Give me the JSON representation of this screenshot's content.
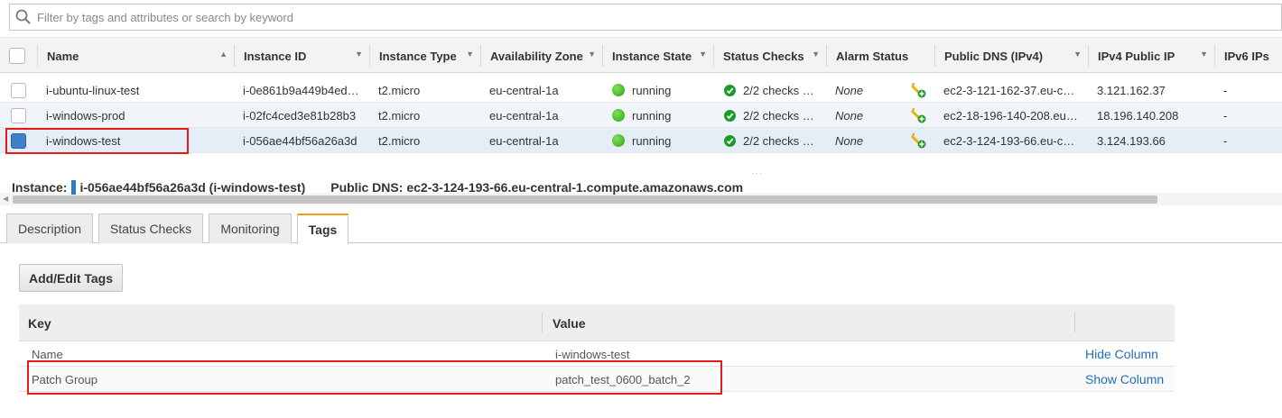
{
  "search": {
    "placeholder": "Filter by tags and attributes or search by keyword"
  },
  "columns": [
    {
      "label": "Name",
      "sort": "▲"
    },
    {
      "label": "Instance ID",
      "sort": "▼"
    },
    {
      "label": "Instance Type",
      "sort": "▼"
    },
    {
      "label": "Availability Zone",
      "sort": "▼"
    },
    {
      "label": "Instance State",
      "sort": "▼"
    },
    {
      "label": "Status Checks",
      "sort": "▼"
    },
    {
      "label": "Alarm Status",
      "sort": ""
    },
    {
      "label": "Public DNS (IPv4)",
      "sort": "▼"
    },
    {
      "label": "IPv4 Public IP",
      "sort": "▼"
    },
    {
      "label": "IPv6 IPs",
      "sort": ""
    }
  ],
  "rows": [
    {
      "name": "i-ubuntu-linux-test",
      "id": "i-0e861b9a449b4ed…",
      "type": "t2.micro",
      "az": "eu-central-1a",
      "state": "running",
      "checks": "2/2 checks …",
      "alarm": "None",
      "dns": "ec2-3-121-162-37.eu-c…",
      "ip": "3.121.162.37",
      "ipv6": "-",
      "selected": false
    },
    {
      "name": "i-windows-prod",
      "id": "i-02fc4ced3e81b28b3",
      "type": "t2.micro",
      "az": "eu-central-1a",
      "state": "running",
      "checks": "2/2 checks …",
      "alarm": "None",
      "dns": "ec2-18-196-140-208.eu…",
      "ip": "18.196.140.208",
      "ipv6": "-",
      "selected": false
    },
    {
      "name": "i-windows-test",
      "id": "i-056ae44bf56a26a3d",
      "type": "t2.micro",
      "az": "eu-central-1a",
      "state": "running",
      "checks": "2/2 checks …",
      "alarm": "None",
      "dns": "ec2-3-124-193-66.eu-c…",
      "ip": "3.124.193.66",
      "ipv6": "-",
      "selected": true
    }
  ],
  "detail": {
    "instance_label": "Instance:",
    "instance_value": "i-056ae44bf56a26a3d (i-windows-test)",
    "dns_label": "Public DNS:",
    "dns_value": "ec2-3-124-193-66.eu-central-1.compute.amazonaws.com"
  },
  "tabs": [
    {
      "label": "Description"
    },
    {
      "label": "Status Checks"
    },
    {
      "label": "Monitoring"
    },
    {
      "label": "Tags",
      "active": true
    }
  ],
  "tags_panel": {
    "add_button": "Add/Edit Tags",
    "key_header": "Key",
    "value_header": "Value",
    "rows": [
      {
        "key": "Name",
        "value": "i-windows-test",
        "action": "Hide Column"
      },
      {
        "key": "Patch Group",
        "value": "patch_test_0600_batch_2",
        "action": "Show Column"
      }
    ]
  },
  "colors": {
    "accent_tab": "#f19f0e",
    "link": "#1f6eb8",
    "highlight": "#e31b1b",
    "checked": "#3f7fcc"
  }
}
